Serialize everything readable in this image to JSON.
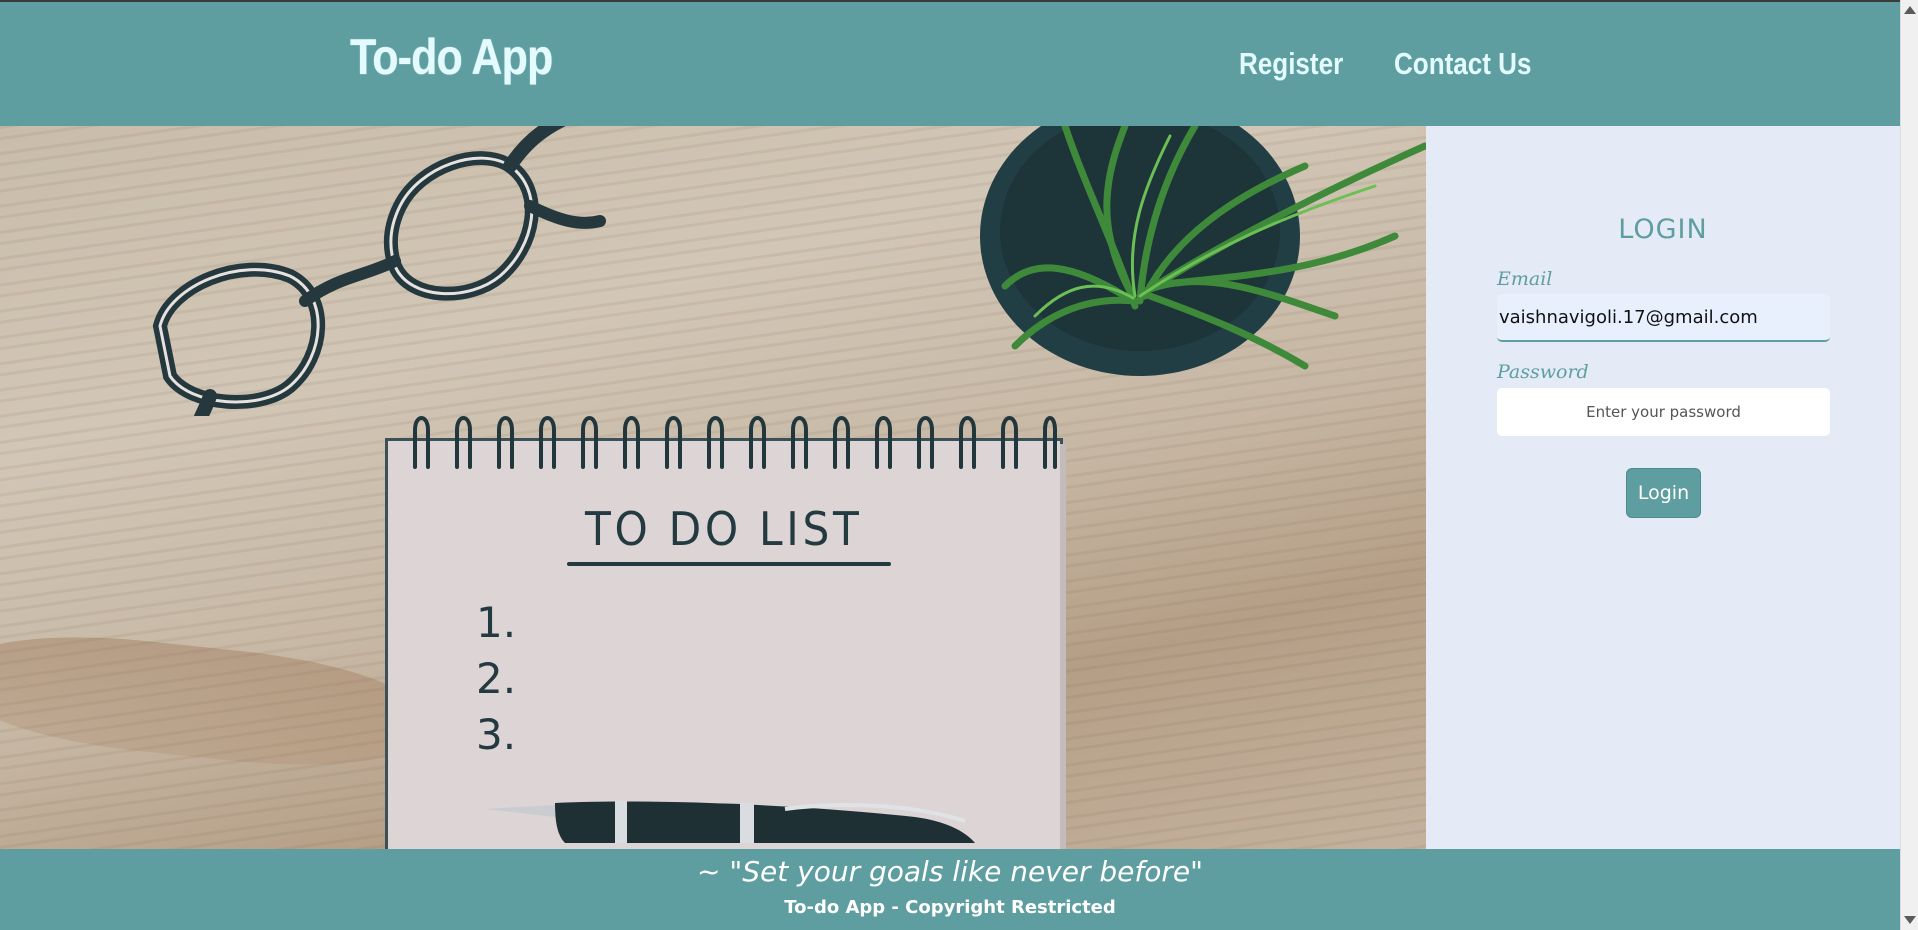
{
  "header": {
    "brand": "To-do App",
    "nav": {
      "register": "Register",
      "contact": "Contact Us"
    }
  },
  "hero": {
    "notebook_title": "TO DO LIST",
    "list_numbers": [
      "1.",
      "2.",
      "3."
    ]
  },
  "login": {
    "title": "LOGIN",
    "email_label": "Email",
    "email_value": "vaishnavigoli.17@gmail.com",
    "password_label": "Password",
    "password_placeholder": "Enter your password",
    "button_label": "Login"
  },
  "footer": {
    "tagline": "~ \"Set your goals like never before\"",
    "copyright": "To-do App - Copyright Restricted"
  },
  "colors": {
    "accent": "#5f9ea0",
    "panel_bg": "#e4ebf6",
    "heading_text": "#e3fbff"
  },
  "icons": {
    "scroll_up": "scroll-up-arrow-icon",
    "scroll_down": "scroll-down-arrow-icon"
  }
}
